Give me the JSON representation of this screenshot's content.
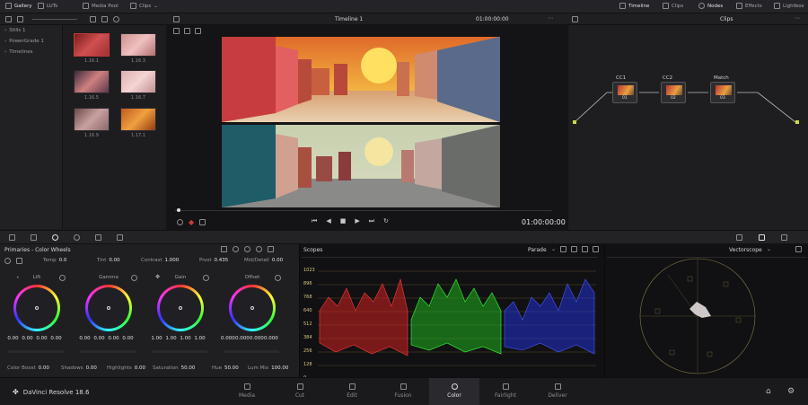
{
  "topbar": {
    "gallery": "Gallery",
    "luts": "LUTs",
    "media_pool": "Media Pool",
    "clips": "Clips",
    "timeline_name": "Timeline 1",
    "timecode": "01:00:00:00",
    "timeline": "Timeline",
    "clips_right": "Clips",
    "nodes": "Nodes",
    "effects": "Effects",
    "lightbox": "Lightbox"
  },
  "sidebar": {
    "items": [
      "Stills 1",
      "PowerGrade 1",
      "Timelines"
    ]
  },
  "gallery": {
    "stills": [
      "1.16.1",
      "1.16.3",
      "1.16.5",
      "1.16.7",
      "1.16.9",
      "1.17.1"
    ]
  },
  "viewer": {
    "timecode": "01:00:00:00"
  },
  "node_editor": {
    "title": "Clips",
    "nodes": [
      {
        "label": "CC1",
        "num": "01"
      },
      {
        "label": "CC2",
        "num": "02"
      },
      {
        "label": "Match",
        "num": "03"
      }
    ]
  },
  "color_wheels": {
    "title": "Primaries - Color Wheels",
    "params": {
      "temp_label": "Temp",
      "temp": "0.0",
      "tint_label": "Tint",
      "tint": "0.00",
      "contrast_label": "Contrast",
      "contrast": "1.000",
      "pivot_label": "Pivot",
      "pivot": "0.435",
      "middetail_label": "Mid/Detail",
      "middetail": "0.00"
    },
    "wheels": [
      {
        "label": "Lift",
        "values": [
          "0.00",
          "0.00",
          "0.00",
          "0.00"
        ]
      },
      {
        "label": "Gamma",
        "values": [
          "0.00",
          "0.00",
          "0.00",
          "0.00"
        ]
      },
      {
        "label": "Gain",
        "values": [
          "1.00",
          "1.00",
          "1.00",
          "1.00"
        ]
      },
      {
        "label": "Offset",
        "values": [
          "0.000",
          "0.000",
          "0.000",
          "0.000"
        ]
      }
    ],
    "bottom": {
      "colorboost_label": "Color Boost",
      "colorboost": "0.00",
      "shadows_label": "Shadows",
      "shadows": "0.00",
      "highlights_label": "Highlights",
      "highlights": "0.00",
      "saturation_label": "Saturation",
      "saturation": "50.00",
      "hue_label": "Hue",
      "hue": "50.00",
      "lummix_label": "Lum Mix",
      "lummix": "100.00"
    }
  },
  "scopes": {
    "title": "Scopes",
    "mode": "Parade",
    "scale": [
      "1023",
      "896",
      "768",
      "640",
      "512",
      "384",
      "256",
      "128",
      "0"
    ]
  },
  "vectorscope": {
    "title": "Vectorscope"
  },
  "app": {
    "name": "DaVinci Resolve 18.6"
  },
  "pages": [
    "Media",
    "Cut",
    "Edit",
    "Fusion",
    "Color",
    "Fairlight",
    "Deliver"
  ],
  "active_page": "Color"
}
